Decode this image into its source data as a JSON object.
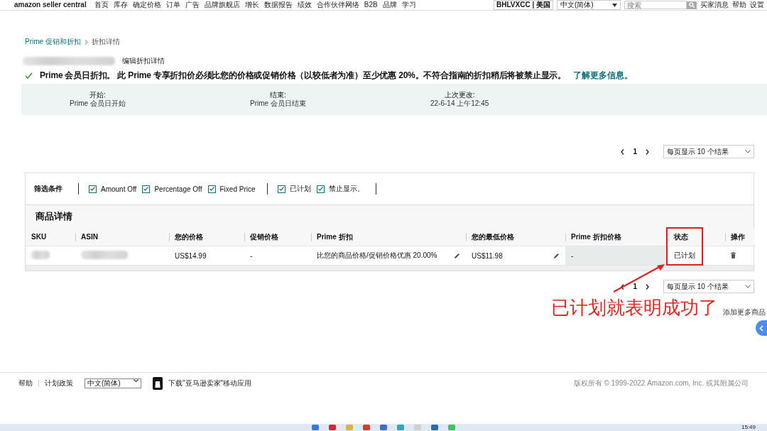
{
  "top_nav": {
    "logo": "amazon seller central",
    "items": [
      "首页",
      "库存",
      "确定价格",
      "订单",
      "广告",
      "品牌旗舰店",
      "增长",
      "数据报告",
      "绩效",
      "合作伙伴网络",
      "B2B",
      "品牌",
      "学习"
    ],
    "account": "BHLVXCC | 美国",
    "language": "中文(简体)",
    "search_placeholder": "搜索",
    "links": [
      "买家消息",
      "帮助",
      "设置"
    ]
  },
  "breadcrumb": [
    "Prime 促销和折扣",
    "折扣详情"
  ],
  "title": {
    "name": {
      "kind": "redacted"
    },
    "edit_link": "编辑折扣详情"
  },
  "notice": {
    "passed": true,
    "text": "Prime 会员日折扣。 此 Prime 专享折扣价必须比您的价格或促销价格（以较低者为准）至少优惠 20%。不符合指南的折扣稍后将被禁止显示。",
    "link": "了解更多信息。"
  },
  "details": [
    {
      "label": "开始:",
      "value": "Prime 会员日开始"
    },
    {
      "label": "结束:",
      "value": "Prime 会员日结束"
    },
    {
      "label": "上次更改:",
      "value": "22-6-14 上午12:45"
    }
  ],
  "pagination_top": {
    "page": "1",
    "page_size": "每页显示 10 个结果"
  },
  "filters": {
    "label": "筛选条件",
    "groups": [
      [
        {
          "label": "Amount Off",
          "checked": true
        },
        {
          "label": "Percentage Off",
          "checked": true
        },
        {
          "label": "Fixed Price",
          "checked": true
        }
      ],
      [
        {
          "label": "已计划",
          "checked": true
        },
        {
          "label": "禁止显示。",
          "checked": true
        }
      ]
    ]
  },
  "table": {
    "title": "商品详情",
    "columns": [
      "SKU",
      "ASIN",
      "您的价格",
      "促销价格",
      "Prime 折扣",
      "您的最低价格",
      "Prime 折扣价格",
      "状态",
      "操作"
    ],
    "rows": [
      {
        "cells": [
          {
            "kind": "redacted"
          },
          {
            "kind": "redacted"
          },
          {
            "kind": "text",
            "text": "US$14.99"
          },
          {
            "kind": "text",
            "text": "-"
          },
          {
            "kind": "editable",
            "text": "比您的商品价格/促销价格优惠 20.00%"
          },
          {
            "kind": "editable",
            "text": "US$11.98"
          },
          {
            "kind": "shaded",
            "text": "-"
          },
          {
            "kind": "text",
            "text": "已计划"
          },
          {
            "kind": "delete"
          }
        ]
      }
    ]
  },
  "pagination_bottom": {
    "page": "1",
    "page_size": "每页显示 10 个结果"
  },
  "add_more": "添加更多商品",
  "annotation": {
    "text": "已计划就表明成功了"
  },
  "footer": {
    "links": [
      "帮助",
      "计划政策"
    ],
    "language": "中文(简体)",
    "app_link": "下载\"亚马逊卖家\"移动应用",
    "copyright": "版权所有 © 1999-2022 Amazon.com, Inc. 或其附属公司"
  },
  "taskbar": {
    "time": "15:49"
  }
}
